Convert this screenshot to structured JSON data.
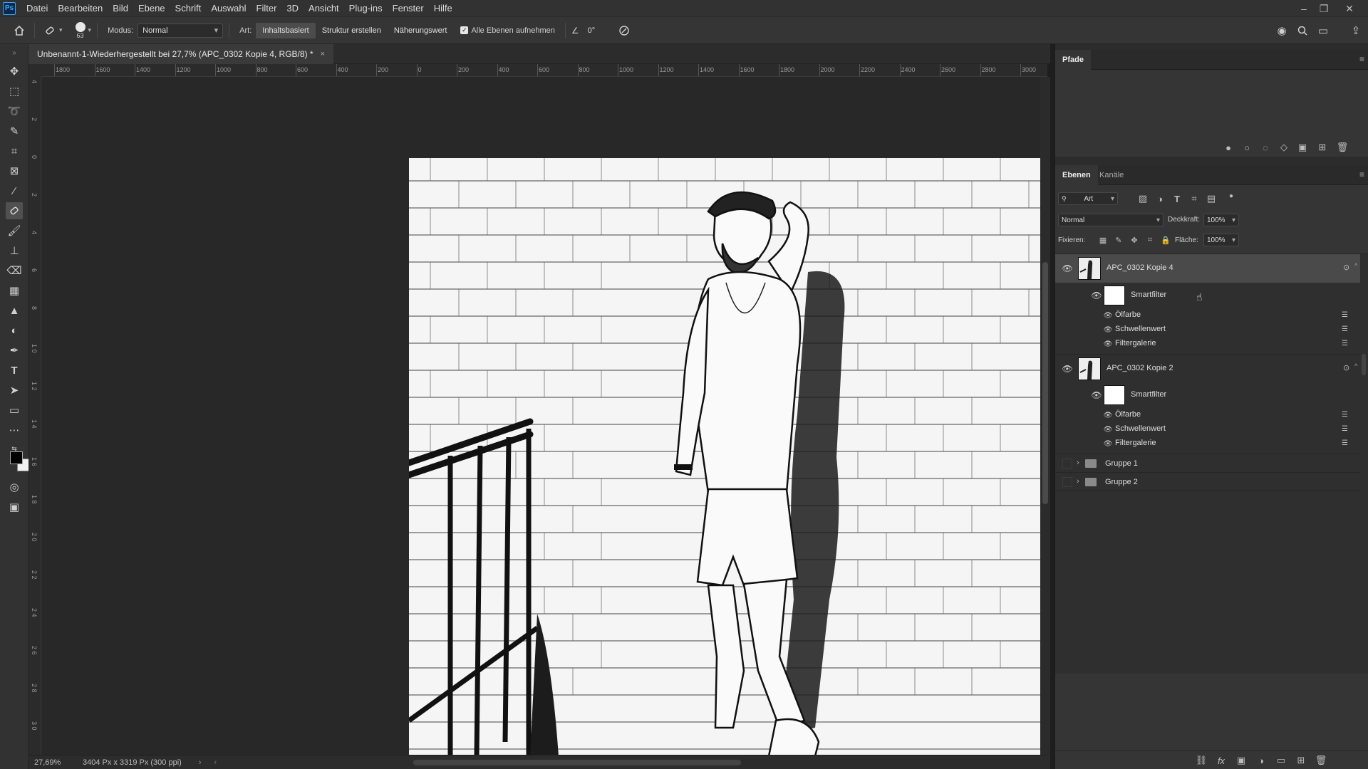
{
  "app": {
    "logo": "Ps"
  },
  "menu": [
    "Datei",
    "Bearbeiten",
    "Bild",
    "Ebene",
    "Schrift",
    "Auswahl",
    "Filter",
    "3D",
    "Ansicht",
    "Plug-ins",
    "Fenster",
    "Hilfe"
  ],
  "options": {
    "brush_size": "63",
    "modus_label": "Modus:",
    "modus_value": "Normal",
    "art_label": "Art:",
    "art_buttons": [
      "Inhaltsbasiert",
      "Struktur erstellen",
      "Näherungswert"
    ],
    "sample_all_label": "Alle Ebenen aufnehmen",
    "angle_value": "0°"
  },
  "document": {
    "tab_title": "Unbenannt-1-Wiederhergestellt bei 27,7% (APC_0302 Kopie 4, RGB/8) *",
    "close": "×"
  },
  "rulers": {
    "horizontal": [
      "1800",
      "1600",
      "1400",
      "1200",
      "1000",
      "800",
      "600",
      "400",
      "200",
      "0",
      "200",
      "400",
      "600",
      "800",
      "1000",
      "1200",
      "1400",
      "1600",
      "1800",
      "2000",
      "2200",
      "2400",
      "2600",
      "2800",
      "3000"
    ],
    "vertical": [
      "4",
      "2",
      "0",
      "2",
      "4",
      "6",
      "8",
      "1 0",
      "1 2",
      "1 4",
      "1 6",
      "1 8",
      "2 0",
      "2 2",
      "2 4",
      "2 6",
      "2 8",
      "3 0"
    ]
  },
  "status": {
    "zoom": "27,69%",
    "doc_info": "3404 Px x 3319 Px (300 ppi)"
  },
  "panels": {
    "paths_tab": "Pfade",
    "layers_tabs": [
      "Ebenen",
      "Kanäle"
    ],
    "filter_kind": "Art",
    "blend_mode": "Normal",
    "opacity_label": "Deckkraft:",
    "opacity_value": "100%",
    "lock_label": "Fixieren:",
    "fill_label": "Fläche:",
    "fill_value": "100%",
    "layers": [
      {
        "name": "APC_0302 Kopie 4",
        "smartfilter": "Smartfilter",
        "filters": [
          "Ölfarbe",
          "Schwellenwert",
          "Filtergalerie"
        ]
      },
      {
        "name": "APC_0302 Kopie 2",
        "smartfilter": "Smartfilter",
        "filters": [
          "Ölfarbe",
          "Schwellenwert",
          "Filtergalerie"
        ]
      }
    ],
    "groups": [
      "Gruppe 1",
      "Gruppe 2"
    ]
  },
  "colors": {
    "accent": "#31a8ff",
    "panel_bg": "#353535",
    "canvas_bg": "#282828",
    "selected_row": "#4a4a4a"
  }
}
